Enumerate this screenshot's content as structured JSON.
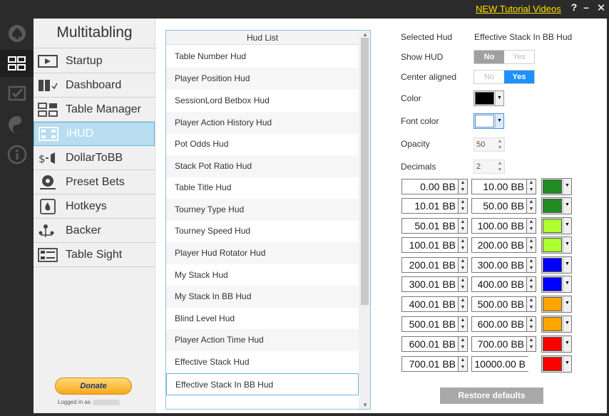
{
  "titlebar": {
    "tutorial_link": "NEW Tutorial Videos",
    "help": "?",
    "minimize": "–",
    "close": "✕"
  },
  "rail": {
    "icons": [
      "spade-icon",
      "grid-icon",
      "checkbox-icon",
      "yin-yang-icon",
      "info-icon"
    ],
    "active_index": 1
  },
  "sidebar": {
    "title": "Multitabling",
    "items": [
      {
        "label": "Startup",
        "icon": "startup-icon"
      },
      {
        "label": "Dashboard",
        "icon": "dashboard-icon"
      },
      {
        "label": "Table Manager",
        "icon": "table-manager-icon"
      },
      {
        "label": "iHUD",
        "icon": "ihud-icon"
      },
      {
        "label": "DollarToBB",
        "icon": "dollar-to-bb-icon"
      },
      {
        "label": "Preset Bets",
        "icon": "preset-bets-icon"
      },
      {
        "label": "Hotkeys",
        "icon": "hotkeys-icon"
      },
      {
        "label": "Backer",
        "icon": "backer-icon"
      },
      {
        "label": "Table Sight",
        "icon": "table-sight-icon"
      }
    ],
    "active_index": 3,
    "donate_label": "Donate",
    "logged_in_label": "Logged in as"
  },
  "hud_list": {
    "header": "Hud List",
    "items": [
      "Table Number Hud",
      "Player Position Hud",
      "SessionLord Betbox Hud",
      "Player Action History Hud",
      "Pot Odds Hud",
      "Stack Pot Ratio Hud",
      "Table Title Hud",
      "Tourney Type Hud",
      "Tourney Speed Hud",
      "Player Hud Rotator Hud",
      "My Stack Hud",
      "My Stack In BB Hud",
      "Blind Level Hud",
      "Player Action Time Hud",
      "Effective Stack Hud",
      "Effective Stack In BB Hud"
    ],
    "selected_index": 15
  },
  "settings": {
    "selected_hud_label": "Selected Hud",
    "selected_hud_value": "Effective Stack In BB Hud",
    "show_hud_label": "Show HUD",
    "show_hud": {
      "no": "No",
      "yes": "Yes",
      "value": "No"
    },
    "center_aligned_label": "Center aligned",
    "center_aligned": {
      "no": "No",
      "yes": "Yes",
      "value": "Yes"
    },
    "color_label": "Color",
    "color_value": "#000000",
    "font_color_label": "Font color",
    "font_color_value": "#ffffff",
    "opacity_label": "Opacity",
    "opacity_value": "50",
    "decimals_label": "Decimals",
    "decimals_value": "2",
    "ranges": [
      {
        "from": "0.00 BB",
        "to": "10.00 BB",
        "color": "#228b22"
      },
      {
        "from": "10.01 BB",
        "to": "50.00 BB",
        "color": "#228b22"
      },
      {
        "from": "50.01 BB",
        "to": "100.00 BB",
        "color": "#adff2f"
      },
      {
        "from": "100.01 BB",
        "to": "200.00 BB",
        "color": "#adff2f"
      },
      {
        "from": "200.01 BB",
        "to": "300.00 BB",
        "color": "#0000ff"
      },
      {
        "from": "300.01 BB",
        "to": "400.00 BB",
        "color": "#0000ff"
      },
      {
        "from": "400.01 BB",
        "to": "500.00 BB",
        "color": "#ffa500"
      },
      {
        "from": "500.01 BB",
        "to": "600.00 BB",
        "color": "#ffa500"
      },
      {
        "from": "600.01 BB",
        "to": "700.00 BB",
        "color": "#ff0000"
      },
      {
        "from": "700.01 BB",
        "to": "10000.00 B",
        "color": "#ff0000"
      }
    ],
    "restore_label": "Restore defaults"
  },
  "colors": {
    "accent": "#1e90ff",
    "selection_border": "#66b8e3",
    "active_nav": "#b8dcf0",
    "link": "#ffe000"
  }
}
